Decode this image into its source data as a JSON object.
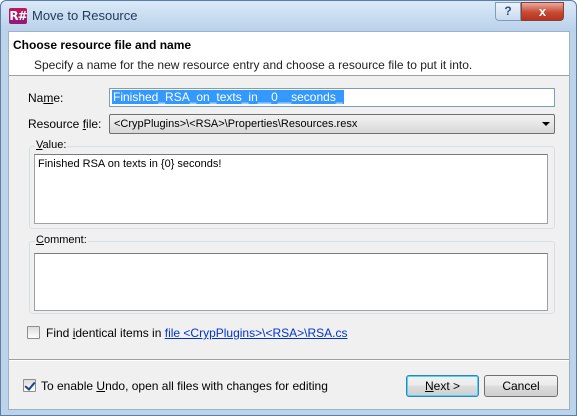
{
  "window": {
    "title": "Move to Resource",
    "app_icon": "resharper-icon",
    "help_glyph": "?",
    "close_glyph": "x"
  },
  "header": {
    "title": "Choose resource file and name",
    "description": "Specify a name for the new resource entry and choose a resource file to put it into."
  },
  "form": {
    "name_label_pre": "Na",
    "name_label_u": "m",
    "name_label_post": "e:",
    "name_value": "Finished_RSA_on_texts_in__0__seconds_",
    "resource_file_label_pre": "Resource ",
    "resource_file_label_u": "f",
    "resource_file_label_post": "ile:",
    "resource_file_value": "<CrypPlugins>\\<RSA>\\Properties\\Resources.resx",
    "value_legend_u": "V",
    "value_legend_post": "alue:",
    "value_text": "Finished RSA on texts in {0} seconds!",
    "comment_legend_u": "C",
    "comment_legend_post": "omment:",
    "comment_text": ""
  },
  "find_identical": {
    "checked": false,
    "label_pre": "Find ",
    "label_u": "i",
    "label_post": "dentical items in ",
    "link_text": "file <CrypPlugins>\\<RSA>\\RSA.cs"
  },
  "footer": {
    "undo_checked": true,
    "undo_label_pre": "To enable ",
    "undo_label_u": "U",
    "undo_label_post": "ndo, open all files with changes for editing",
    "next_label_u": "N",
    "next_label_post": "ext >",
    "cancel_label": "Cancel"
  },
  "colors": {
    "selection": "#3399ff",
    "link": "#0033cc",
    "close_button": "#c74a33"
  }
}
